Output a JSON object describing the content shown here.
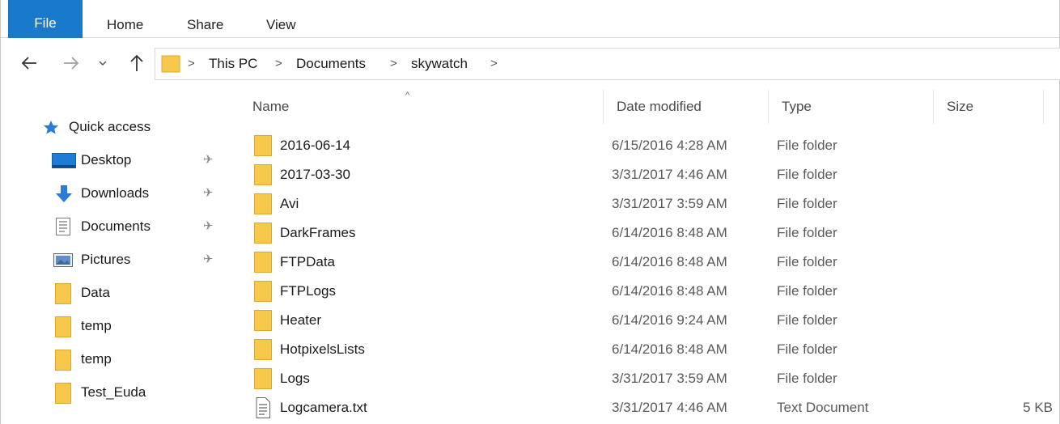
{
  "ribbon": {
    "tabs": [
      {
        "label": "File",
        "active": true
      },
      {
        "label": "Home"
      },
      {
        "label": "Share"
      },
      {
        "label": "View"
      }
    ]
  },
  "nav": {
    "back_icon": "arrow-left-icon",
    "forward_icon": "arrow-right-icon",
    "recent_icon": "chevron-down-icon",
    "up_icon": "arrow-up-icon",
    "separator": ">"
  },
  "address": {
    "crumbs": [
      "This PC",
      "Documents",
      "skywatch"
    ]
  },
  "sidebar": {
    "items": [
      {
        "label": "Quick access",
        "icon": "star-icon"
      },
      {
        "label": "Desktop",
        "icon": "desktop-icon",
        "pinned": true
      },
      {
        "label": "Downloads",
        "icon": "download-icon",
        "pinned": true
      },
      {
        "label": "Documents",
        "icon": "documents-icon",
        "pinned": true
      },
      {
        "label": "Pictures",
        "icon": "pictures-icon",
        "pinned": true
      },
      {
        "label": "Data",
        "icon": "folder-icon"
      },
      {
        "label": "temp",
        "icon": "folder-icon"
      },
      {
        "label": "temp",
        "icon": "folder-icon"
      },
      {
        "label": "Test_Euda",
        "icon": "folder-icon"
      }
    ],
    "pin_glyph": "✈"
  },
  "columns": {
    "name": "Name",
    "date": "Date modified",
    "type": "Type",
    "size": "Size",
    "sort_glyph": "^"
  },
  "files": [
    {
      "name": "2016-06-14",
      "date": "6/15/2016 4:28 AM",
      "type": "File folder",
      "size": "",
      "icon": "folder-icon"
    },
    {
      "name": "2017-03-30",
      "date": "3/31/2017 4:46 AM",
      "type": "File folder",
      "size": "",
      "icon": "folder-icon"
    },
    {
      "name": "Avi",
      "date": "3/31/2017 3:59 AM",
      "type": "File folder",
      "size": "",
      "icon": "folder-icon"
    },
    {
      "name": "DarkFrames",
      "date": "6/14/2016 8:48 AM",
      "type": "File folder",
      "size": "",
      "icon": "folder-icon"
    },
    {
      "name": "FTPData",
      "date": "6/14/2016 8:48 AM",
      "type": "File folder",
      "size": "",
      "icon": "folder-icon"
    },
    {
      "name": "FTPLogs",
      "date": "6/14/2016 8:48 AM",
      "type": "File folder",
      "size": "",
      "icon": "folder-icon"
    },
    {
      "name": "Heater",
      "date": "6/14/2016 9:24 AM",
      "type": "File folder",
      "size": "",
      "icon": "folder-icon"
    },
    {
      "name": "HotpixelsLists",
      "date": "6/14/2016 8:48 AM",
      "type": "File folder",
      "size": "",
      "icon": "folder-icon"
    },
    {
      "name": "Logs",
      "date": "3/31/2017 3:59 AM",
      "type": "File folder",
      "size": "",
      "icon": "folder-icon"
    },
    {
      "name": "Logcamera.txt",
      "date": "3/31/2017 4:46 AM",
      "type": "Text Document",
      "size": "5 KB",
      "icon": "text-file-icon"
    }
  ],
  "colors": {
    "accent": "#1979ca",
    "folder": "#f6c84c",
    "folder_dark": "#dfa82c"
  }
}
